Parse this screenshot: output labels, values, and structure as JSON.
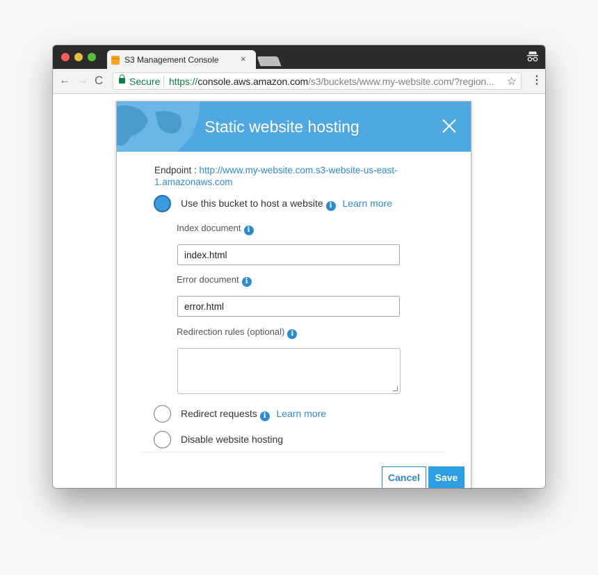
{
  "browser": {
    "tab_title": "S3 Management Console",
    "tab_close": "×",
    "secure_label": "Secure",
    "url_scheme": "https://",
    "url_host": "console.aws.amazon.com",
    "url_path": "/s3/buckets/www.my-website.com/?region...",
    "bookmark_star": "☆",
    "menu": "⋮"
  },
  "modal": {
    "title": "Static website hosting",
    "endpoint_label": "Endpoint : ",
    "endpoint_url_line1": "http://www.my-website.com.s3-website-us-east-",
    "endpoint_url_line2": "1.amazonaws.com",
    "options": [
      {
        "label": "Use this bucket to host a website",
        "learn_more": "Learn more",
        "selected": true
      },
      {
        "label": "Redirect requests",
        "learn_more": "Learn more",
        "selected": false
      },
      {
        "label": "Disable website hosting",
        "selected": false
      }
    ],
    "index_document": {
      "label": "Index document",
      "value": "index.html"
    },
    "error_document": {
      "label": "Error document",
      "value": "error.html"
    },
    "redirection_rules": {
      "label": "Redirection rules (optional)",
      "value": ""
    },
    "buttons": {
      "cancel": "Cancel",
      "save": "Save"
    }
  },
  "colors": {
    "header_blue": "#50a8e0",
    "link_blue": "#2e8bcb",
    "secure_green": "#0b8043"
  },
  "icons": {
    "close": "close-icon",
    "info": "info-icon",
    "lock": "lock-icon"
  }
}
